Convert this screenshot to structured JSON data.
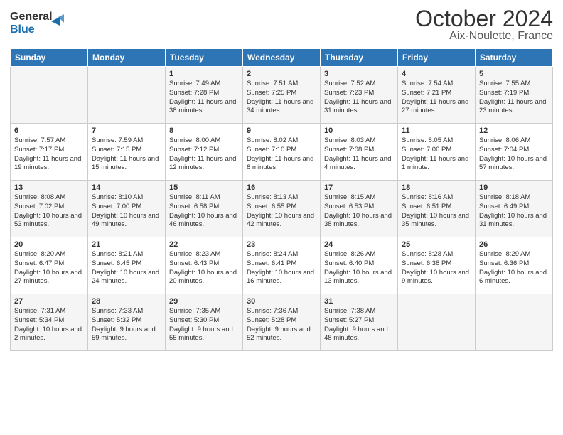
{
  "header": {
    "logo_line1": "General",
    "logo_line2": "Blue",
    "month": "October 2024",
    "location": "Aix-Noulette, France"
  },
  "days_of_week": [
    "Sunday",
    "Monday",
    "Tuesday",
    "Wednesday",
    "Thursday",
    "Friday",
    "Saturday"
  ],
  "weeks": [
    [
      {
        "day": "",
        "content": ""
      },
      {
        "day": "",
        "content": ""
      },
      {
        "day": "1",
        "content": "Sunrise: 7:49 AM\nSunset: 7:28 PM\nDaylight: 11 hours and 38 minutes."
      },
      {
        "day": "2",
        "content": "Sunrise: 7:51 AM\nSunset: 7:25 PM\nDaylight: 11 hours and 34 minutes."
      },
      {
        "day": "3",
        "content": "Sunrise: 7:52 AM\nSunset: 7:23 PM\nDaylight: 11 hours and 31 minutes."
      },
      {
        "day": "4",
        "content": "Sunrise: 7:54 AM\nSunset: 7:21 PM\nDaylight: 11 hours and 27 minutes."
      },
      {
        "day": "5",
        "content": "Sunrise: 7:55 AM\nSunset: 7:19 PM\nDaylight: 11 hours and 23 minutes."
      }
    ],
    [
      {
        "day": "6",
        "content": "Sunrise: 7:57 AM\nSunset: 7:17 PM\nDaylight: 11 hours and 19 minutes."
      },
      {
        "day": "7",
        "content": "Sunrise: 7:59 AM\nSunset: 7:15 PM\nDaylight: 11 hours and 15 minutes."
      },
      {
        "day": "8",
        "content": "Sunrise: 8:00 AM\nSunset: 7:12 PM\nDaylight: 11 hours and 12 minutes."
      },
      {
        "day": "9",
        "content": "Sunrise: 8:02 AM\nSunset: 7:10 PM\nDaylight: 11 hours and 8 minutes."
      },
      {
        "day": "10",
        "content": "Sunrise: 8:03 AM\nSunset: 7:08 PM\nDaylight: 11 hours and 4 minutes."
      },
      {
        "day": "11",
        "content": "Sunrise: 8:05 AM\nSunset: 7:06 PM\nDaylight: 11 hours and 1 minute."
      },
      {
        "day": "12",
        "content": "Sunrise: 8:06 AM\nSunset: 7:04 PM\nDaylight: 10 hours and 57 minutes."
      }
    ],
    [
      {
        "day": "13",
        "content": "Sunrise: 8:08 AM\nSunset: 7:02 PM\nDaylight: 10 hours and 53 minutes."
      },
      {
        "day": "14",
        "content": "Sunrise: 8:10 AM\nSunset: 7:00 PM\nDaylight: 10 hours and 49 minutes."
      },
      {
        "day": "15",
        "content": "Sunrise: 8:11 AM\nSunset: 6:58 PM\nDaylight: 10 hours and 46 minutes."
      },
      {
        "day": "16",
        "content": "Sunrise: 8:13 AM\nSunset: 6:55 PM\nDaylight: 10 hours and 42 minutes."
      },
      {
        "day": "17",
        "content": "Sunrise: 8:15 AM\nSunset: 6:53 PM\nDaylight: 10 hours and 38 minutes."
      },
      {
        "day": "18",
        "content": "Sunrise: 8:16 AM\nSunset: 6:51 PM\nDaylight: 10 hours and 35 minutes."
      },
      {
        "day": "19",
        "content": "Sunrise: 8:18 AM\nSunset: 6:49 PM\nDaylight: 10 hours and 31 minutes."
      }
    ],
    [
      {
        "day": "20",
        "content": "Sunrise: 8:20 AM\nSunset: 6:47 PM\nDaylight: 10 hours and 27 minutes."
      },
      {
        "day": "21",
        "content": "Sunrise: 8:21 AM\nSunset: 6:45 PM\nDaylight: 10 hours and 24 minutes."
      },
      {
        "day": "22",
        "content": "Sunrise: 8:23 AM\nSunset: 6:43 PM\nDaylight: 10 hours and 20 minutes."
      },
      {
        "day": "23",
        "content": "Sunrise: 8:24 AM\nSunset: 6:41 PM\nDaylight: 10 hours and 16 minutes."
      },
      {
        "day": "24",
        "content": "Sunrise: 8:26 AM\nSunset: 6:40 PM\nDaylight: 10 hours and 13 minutes."
      },
      {
        "day": "25",
        "content": "Sunrise: 8:28 AM\nSunset: 6:38 PM\nDaylight: 10 hours and 9 minutes."
      },
      {
        "day": "26",
        "content": "Sunrise: 8:29 AM\nSunset: 6:36 PM\nDaylight: 10 hours and 6 minutes."
      }
    ],
    [
      {
        "day": "27",
        "content": "Sunrise: 7:31 AM\nSunset: 5:34 PM\nDaylight: 10 hours and 2 minutes."
      },
      {
        "day": "28",
        "content": "Sunrise: 7:33 AM\nSunset: 5:32 PM\nDaylight: 9 hours and 59 minutes."
      },
      {
        "day": "29",
        "content": "Sunrise: 7:35 AM\nSunset: 5:30 PM\nDaylight: 9 hours and 55 minutes."
      },
      {
        "day": "30",
        "content": "Sunrise: 7:36 AM\nSunset: 5:28 PM\nDaylight: 9 hours and 52 minutes."
      },
      {
        "day": "31",
        "content": "Sunrise: 7:38 AM\nSunset: 5:27 PM\nDaylight: 9 hours and 48 minutes."
      },
      {
        "day": "",
        "content": ""
      },
      {
        "day": "",
        "content": ""
      }
    ]
  ]
}
